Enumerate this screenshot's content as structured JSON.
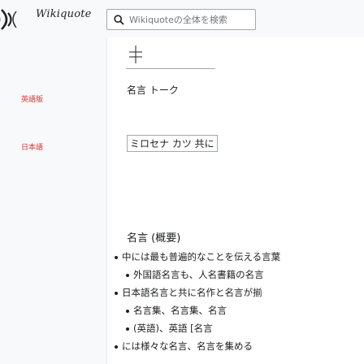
{
  "header": {
    "logo_text": "Wikiquote",
    "search_placeholder": "Wikiquoteの全体を検索"
  },
  "sidebar": {
    "label1": "英語版",
    "label2": "日本語"
  },
  "content": {
    "line1": "名言 トーク",
    "line2": "ミロセナ カツ 共に",
    "heading": "名言 (概要)",
    "bullets": [
      "中には最も普遍的なことを伝える言葉",
      "外国語名言も、人名書籍の名言",
      "日本語名言と共に名作と名言が揃",
      "名言集、名言集、名言",
      "(英語)、英語 [名言",
      "には様々な名言、名言を集める"
    ]
  },
  "colors": {
    "accent": "#3366cc",
    "link_red": "#dd3333",
    "border": "#a2a9b1"
  }
}
